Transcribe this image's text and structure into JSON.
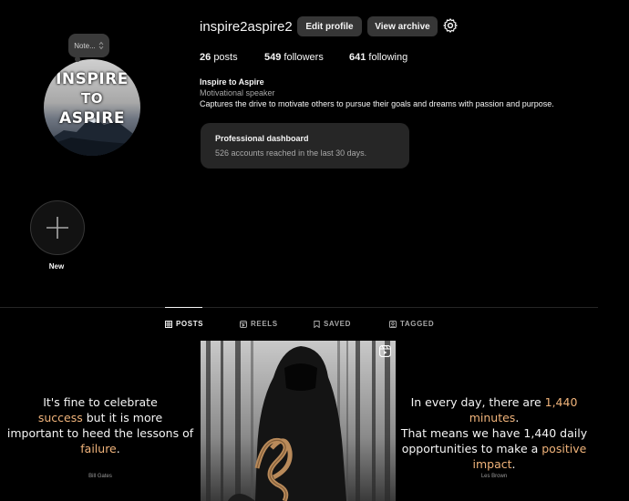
{
  "profile": {
    "username": "inspire2aspire2",
    "avatar_text_line1": "INSPIRE",
    "avatar_text_line2": "TO",
    "avatar_text_line3": "ASPIRE",
    "note_label": "Note...",
    "edit_profile_label": "Edit profile",
    "view_archive_label": "View archive",
    "settings_icon": "gear-icon"
  },
  "stats": {
    "posts_count": "26",
    "posts_label": "posts",
    "followers_count": "549",
    "followers_label": "followers",
    "following_count": "641",
    "following_label": "following"
  },
  "bio": {
    "name": "Inspire to Aspire",
    "category": "Motivational speaker",
    "text": "Captures the drive to motivate others to pursue their goals and dreams with passion and purpose."
  },
  "dashboard": {
    "title": "Professional dashboard",
    "subtitle": "526 accounts reached in the last 30 days."
  },
  "highlights": {
    "new_label": "New"
  },
  "tabs": [
    {
      "label": "POSTS",
      "icon": "grid-icon",
      "active": true
    },
    {
      "label": "REELS",
      "icon": "reels-icon",
      "active": false
    },
    {
      "label": "SAVED",
      "icon": "bookmark-icon",
      "active": false
    },
    {
      "label": "TAGGED",
      "icon": "tagged-icon",
      "active": false
    }
  ],
  "posts": [
    {
      "quote_parts": {
        "l1": "It's fine to celebrate",
        "l2_hl": "success",
        "l2_rest": " but it is more",
        "l3": "important to heed the lessons of",
        "l4_hl": "failure",
        "l4_rest": "."
      },
      "author": "Bill Gates"
    },
    {
      "type": "reel",
      "icon": "reel-icon"
    },
    {
      "quote_parts": {
        "l1_a": "In every day, there are ",
        "l1_hl": "1,440 minutes",
        "l1_b": ".",
        "l2": "That means we have 1,440 daily",
        "l3_a": "opportunities to make a ",
        "l3_hl": "positive",
        "l4_hl": "impact",
        "l4_b": "."
      },
      "author": "Les Brown"
    }
  ],
  "colors": {
    "background": "#000000",
    "button": "#363636",
    "card": "#262626",
    "muted_text": "#a8a8a8",
    "highlight": "#f0b37a"
  }
}
